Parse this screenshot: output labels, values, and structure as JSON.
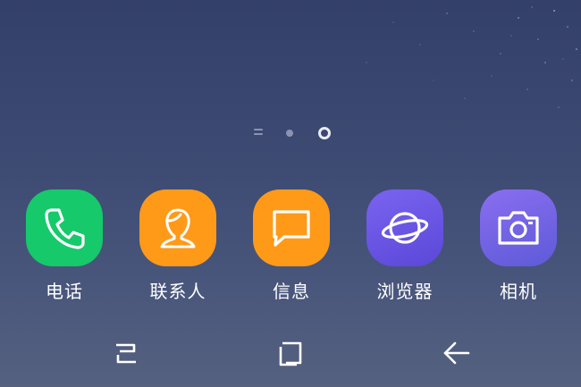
{
  "page_indicator": {
    "pages": 2,
    "current_page": 2,
    "home_marker": "lines"
  },
  "dock": {
    "apps": [
      {
        "label": "电话",
        "icon": "phone-icon",
        "color": "#16c96b"
      },
      {
        "label": "联系人",
        "icon": "contacts-icon",
        "color": "#ff9a19"
      },
      {
        "label": "信息",
        "icon": "messages-icon",
        "color": "#ff9a19"
      },
      {
        "label": "浏览器",
        "icon": "browser-icon",
        "color": "#6a55e6"
      },
      {
        "label": "相机",
        "icon": "camera-icon",
        "color": "#6f63e3"
      }
    ]
  },
  "navigation": {
    "recents_icon": "recent-apps-icon",
    "home_icon": "home-icon",
    "back_icon": "back-arrow-icon"
  },
  "colors": {
    "wallpaper_top": "#33406a",
    "wallpaper_bottom": "#55617f",
    "icon_stroke": "#ffffff"
  }
}
